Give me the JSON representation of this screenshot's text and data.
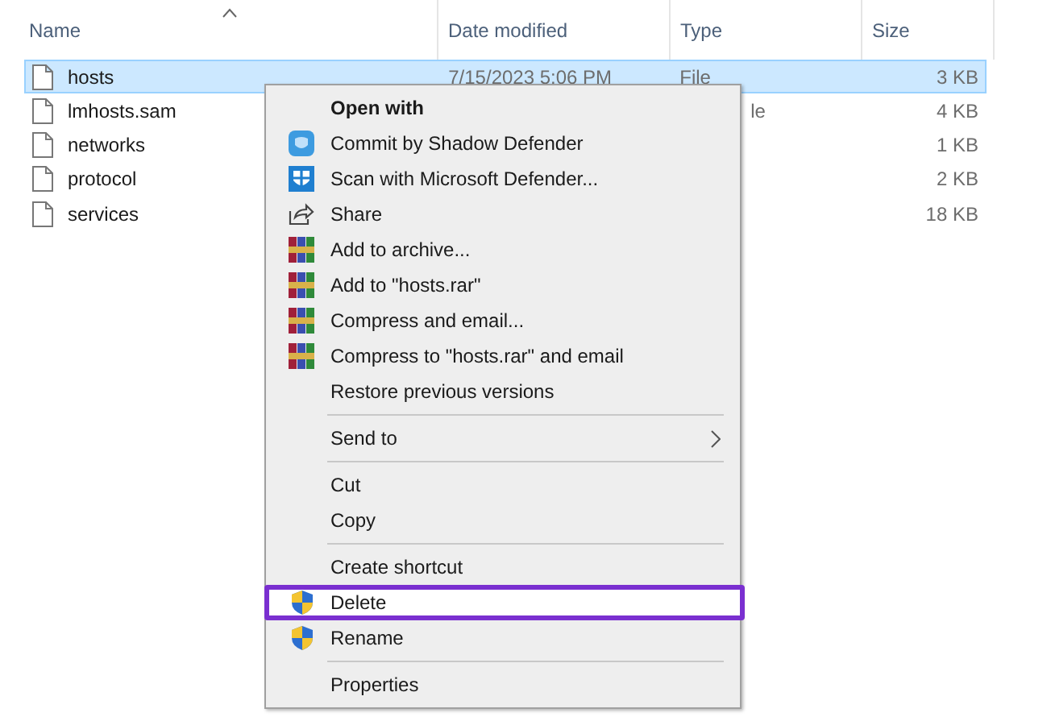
{
  "columns": [
    {
      "label": "Name",
      "sorted": true
    },
    {
      "label": "Date modified",
      "sorted": false
    },
    {
      "label": "Type",
      "sorted": false
    },
    {
      "label": "Size",
      "sorted": false
    }
  ],
  "files": [
    {
      "name": "hosts",
      "date": "7/15/2023 5:06 PM",
      "type": "File",
      "type_cut": false,
      "size": "3 KB",
      "selected": true
    },
    {
      "name": "lmhosts.sam",
      "type": "le",
      "type_cut": true,
      "size": "4 KB",
      "selected": false
    },
    {
      "name": "networks",
      "size": "1 KB",
      "selected": false
    },
    {
      "name": "protocol",
      "size": "2 KB",
      "selected": false
    },
    {
      "name": "services",
      "size": "18 KB",
      "selected": false
    }
  ],
  "context_menu": [
    {
      "kind": "item",
      "label": "Open with",
      "bold": true,
      "highlighted": false
    },
    {
      "kind": "app",
      "label": "Commit by Shadow Defender",
      "bold": false,
      "highlighted": false
    },
    {
      "kind": "defender",
      "label": "Scan with Microsoft Defender...",
      "bold": false,
      "highlighted": false
    },
    {
      "kind": "share",
      "label": "Share",
      "bold": false,
      "highlighted": false
    },
    {
      "kind": "archive",
      "label": "Add to archive...",
      "bold": false,
      "highlighted": false
    },
    {
      "kind": "archive",
      "label": "Add to \"hosts.rar\"",
      "bold": false,
      "highlighted": false
    },
    {
      "kind": "archive",
      "label": "Compress and email...",
      "bold": false,
      "highlighted": false
    },
    {
      "kind": "archive",
      "label": "Compress to \"hosts.rar\" and email",
      "bold": false,
      "highlighted": false
    },
    {
      "kind": "item",
      "label": "Restore previous versions",
      "bold": false,
      "highlighted": false
    },
    {
      "kind": "separator"
    },
    {
      "kind": "submenu",
      "label": "Send to",
      "bold": false,
      "highlighted": false
    },
    {
      "kind": "separator"
    },
    {
      "kind": "item",
      "label": "Cut",
      "bold": false,
      "highlighted": false
    },
    {
      "kind": "item",
      "label": "Copy",
      "bold": false,
      "highlighted": false
    },
    {
      "kind": "separator"
    },
    {
      "kind": "item",
      "label": "Create shortcut",
      "bold": false,
      "highlighted": false
    },
    {
      "kind": "shield",
      "label": "Delete",
      "bold": false,
      "highlighted": true
    },
    {
      "kind": "shield",
      "label": "Rename",
      "bold": false,
      "highlighted": false
    },
    {
      "kind": "separator"
    },
    {
      "kind": "item",
      "label": "Properties",
      "bold": false,
      "highlighted": false
    }
  ]
}
